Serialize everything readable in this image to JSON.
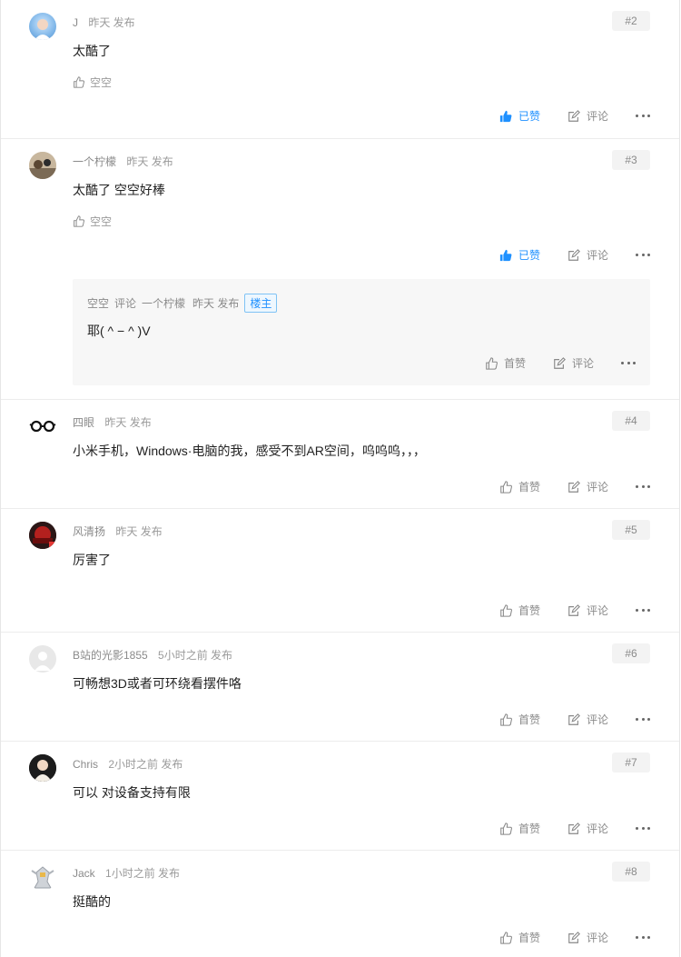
{
  "colors": {
    "accent": "#1e90ff",
    "muted": "#9a9a9a"
  },
  "comments": [
    {
      "name": "J",
      "time": "昨天 发布",
      "floor": "#2",
      "content": "太酷了",
      "liker": "空空",
      "like_label": "已赞",
      "liked": true,
      "comment_label": "评论"
    },
    {
      "name": "一个柠檬",
      "time": "昨天 发布",
      "floor": "#3",
      "content": "太酷了 空空好棒",
      "liker": "空空",
      "like_label": "已赞",
      "liked": true,
      "comment_label": "评论",
      "reply": {
        "from": "空空",
        "verb": "评论",
        "to": "一个柠檬",
        "time": "昨天 发布",
        "tag": "楼主",
        "content": "耶( ^ − ^ )V",
        "like_label": "首赞",
        "comment_label": "评论"
      }
    },
    {
      "name": "四眼",
      "time": "昨天 发布",
      "floor": "#4",
      "content": "小米手机，Windows·电脑的我，感受不到AR空间，呜呜呜，，，",
      "like_label": "首赞",
      "liked": false,
      "comment_label": "评论"
    },
    {
      "name": "风清扬",
      "time": "昨天 发布",
      "floor": "#5",
      "content": "厉害了",
      "like_label": "首赞",
      "liked": false,
      "comment_label": "评论"
    },
    {
      "name": "B站的光影1855",
      "time": "5小时之前 发布",
      "floor": "#6",
      "content": "可畅想3D或者可环绕看摆件咯",
      "like_label": "首赞",
      "liked": false,
      "comment_label": "评论"
    },
    {
      "name": "Chris",
      "time": "2小时之前 发布",
      "floor": "#7",
      "content": "可以 对设备支持有限",
      "like_label": "首赞",
      "liked": false,
      "comment_label": "评论"
    },
    {
      "name": "Jack",
      "time": "1小时之前 发布",
      "floor": "#8",
      "content": "挺酷的",
      "like_label": "首赞",
      "liked": false,
      "comment_label": "评论"
    }
  ]
}
